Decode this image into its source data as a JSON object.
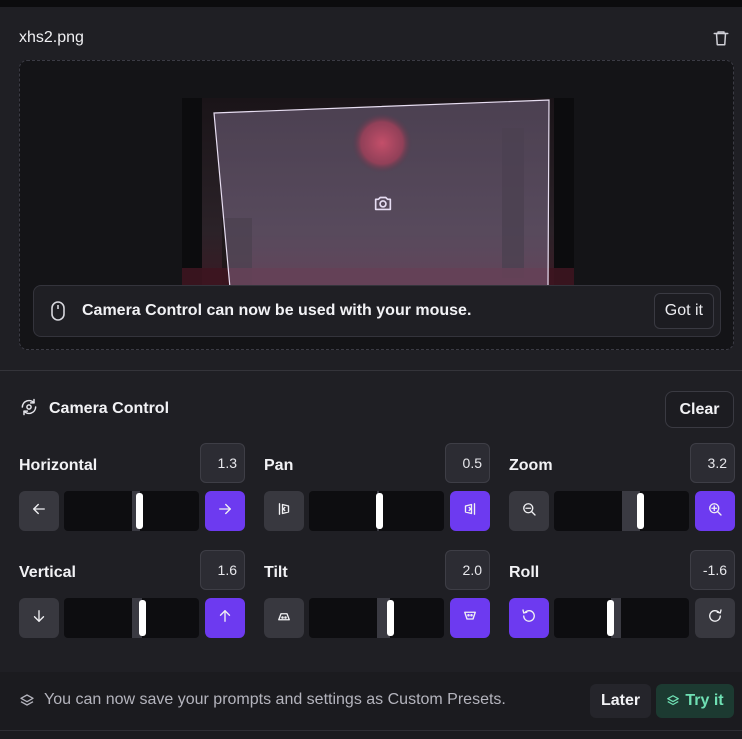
{
  "file": {
    "name": "xhs2.png"
  },
  "toast": {
    "message": "Camera Control can now be used with your mouse.",
    "dismiss_label": "Got it"
  },
  "camera_control": {
    "title": "Camera Control",
    "clear_label": "Clear",
    "controls": [
      {
        "label": "Horizontal",
        "value": "1.3",
        "left_icon": "arrow-left-icon",
        "right_icon": "arrow-right-icon",
        "active_side": "right",
        "level": 0.56
      },
      {
        "label": "Pan",
        "value": "0.5",
        "left_icon": "pan-left-icon",
        "right_icon": "pan-right-icon",
        "active_side": "right",
        "level": 0.52
      },
      {
        "label": "Zoom",
        "value": "3.2",
        "left_icon": "zoom-out-icon",
        "right_icon": "zoom-in-icon",
        "active_side": "right",
        "level": 0.64
      },
      {
        "label": "Vertical",
        "value": "1.6",
        "left_icon": "arrow-down-icon",
        "right_icon": "arrow-up-icon",
        "active_side": "right",
        "level": 0.58
      },
      {
        "label": "Tilt",
        "value": "2.0",
        "left_icon": "tilt-down-icon",
        "right_icon": "tilt-up-icon",
        "active_side": "right",
        "level": 0.6
      },
      {
        "label": "Roll",
        "value": "-1.6",
        "left_icon": "rotate-ccw-icon",
        "right_icon": "rotate-cw-icon",
        "active_side": "left",
        "level": 0.42
      }
    ]
  },
  "banner": {
    "text": "You can now save your prompts and settings as Custom Presets.",
    "later_label": "Later",
    "try_label": "Try it"
  },
  "colors": {
    "accent": "#6d3af0",
    "background": "#1f1f24",
    "try_text": "#6fe0b4",
    "try_bg": "#1c3a31"
  }
}
